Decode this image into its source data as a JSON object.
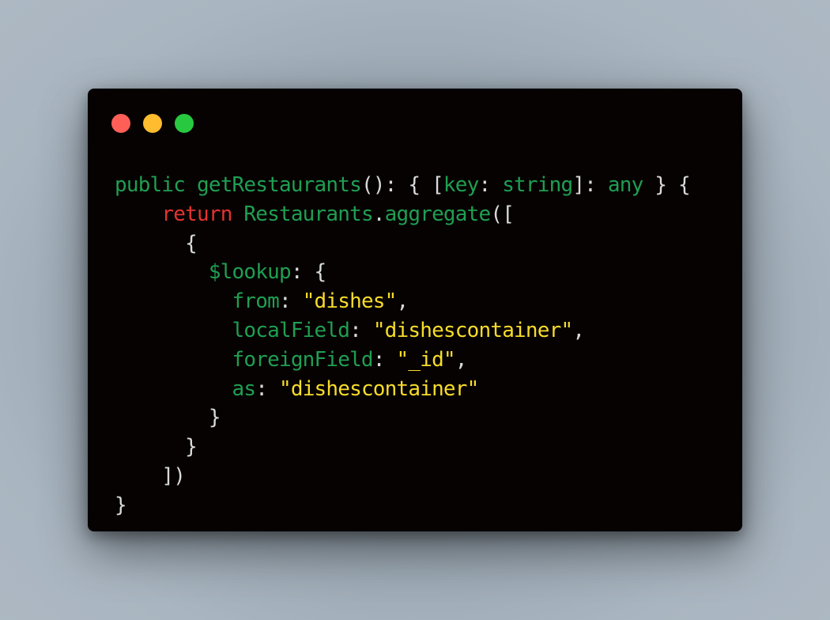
{
  "window": {
    "controls": [
      {
        "name": "close",
        "color": "#ff5f57"
      },
      {
        "name": "minimize",
        "color": "#febc2e"
      },
      {
        "name": "zoom",
        "color": "#28c840"
      }
    ]
  },
  "colors": {
    "background": "#a3afba",
    "editor": "#060202",
    "keyword_green": "#1f9f52",
    "keyword_red": "#e3342f",
    "punctuation": "#d9d9d9",
    "string": "#f7dc2a"
  },
  "code": {
    "lines": [
      {
        "indent": "",
        "tokens": [
          {
            "t": "public ",
            "c": "kw-green"
          },
          {
            "t": "getRestaurants",
            "c": "kw-green"
          },
          {
            "t": "(): { [",
            "c": "punc"
          },
          {
            "t": "key",
            "c": "kw-green"
          },
          {
            "t": ": ",
            "c": "punc"
          },
          {
            "t": "string",
            "c": "kw-green"
          },
          {
            "t": "]: ",
            "c": "punc"
          },
          {
            "t": "any",
            "c": "kw-green"
          },
          {
            "t": " } {",
            "c": "punc"
          }
        ]
      },
      {
        "indent": "    ",
        "tokens": [
          {
            "t": "return ",
            "c": "kw-red"
          },
          {
            "t": "Restaurants",
            "c": "kw-green"
          },
          {
            "t": ".",
            "c": "punc"
          },
          {
            "t": "aggregate",
            "c": "kw-green"
          },
          {
            "t": "([",
            "c": "punc"
          }
        ]
      },
      {
        "indent": "      ",
        "tokens": [
          {
            "t": "{",
            "c": "punc"
          }
        ]
      },
      {
        "indent": "        ",
        "tokens": [
          {
            "t": "$lookup",
            "c": "kw-green"
          },
          {
            "t": ": {",
            "c": "punc"
          }
        ]
      },
      {
        "indent": "          ",
        "tokens": [
          {
            "t": "from",
            "c": "kw-green"
          },
          {
            "t": ": ",
            "c": "punc"
          },
          {
            "t": "\"dishes\"",
            "c": "str"
          },
          {
            "t": ",",
            "c": "punc"
          }
        ]
      },
      {
        "indent": "          ",
        "tokens": [
          {
            "t": "localField",
            "c": "kw-green"
          },
          {
            "t": ": ",
            "c": "punc"
          },
          {
            "t": "\"dishescontainer\"",
            "c": "str"
          },
          {
            "t": ",",
            "c": "punc"
          }
        ]
      },
      {
        "indent": "          ",
        "tokens": [
          {
            "t": "foreignField",
            "c": "kw-green"
          },
          {
            "t": ": ",
            "c": "punc"
          },
          {
            "t": "\"_id\"",
            "c": "str"
          },
          {
            "t": ",",
            "c": "punc"
          }
        ]
      },
      {
        "indent": "          ",
        "tokens": [
          {
            "t": "as",
            "c": "kw-green"
          },
          {
            "t": ": ",
            "c": "punc"
          },
          {
            "t": "\"dishescontainer\"",
            "c": "str"
          }
        ]
      },
      {
        "indent": "        ",
        "tokens": [
          {
            "t": "}",
            "c": "punc"
          }
        ]
      },
      {
        "indent": "      ",
        "tokens": [
          {
            "t": "}",
            "c": "punc"
          }
        ]
      },
      {
        "indent": "    ",
        "tokens": [
          {
            "t": "])",
            "c": "punc"
          }
        ]
      },
      {
        "indent": "",
        "tokens": [
          {
            "t": "}",
            "c": "punc"
          }
        ]
      }
    ]
  }
}
